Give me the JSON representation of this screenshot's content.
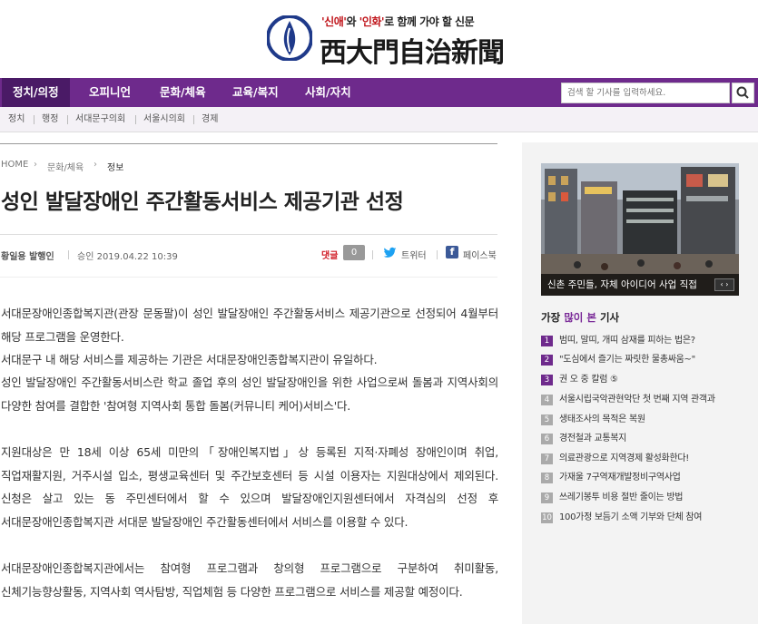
{
  "masthead": {
    "slogan_q1": "'신애'",
    "slogan_mid": "와",
    "slogan_q2": "'인화'",
    "slogan_rest": "로 함께 가야 할 신문",
    "name": "西大門自治新聞"
  },
  "nav": {
    "items": [
      "정치/의정",
      "오피니언",
      "문화/체육",
      "교육/복지",
      "사회/자치"
    ],
    "active_index": 0,
    "search_placeholder": "검색 할 기사를 입력하세요."
  },
  "subnav": {
    "items": [
      "정치",
      "행정",
      "서대문구의회",
      "서울시의회",
      "경제"
    ]
  },
  "breadcrumb": {
    "home": "HOME",
    "section": "문화/체육",
    "current": "정보"
  },
  "article": {
    "headline": "성인 발달장애인 주간활동서비스 제공기관 선정",
    "author": "황일용 발행인",
    "approved": "승인 2019.04.22 10:39",
    "comment_label": "댓글",
    "comment_count": "0",
    "twitter_label": "트위터",
    "facebook_label": "페이스북",
    "paragraphs": [
      "서대문장애인종합복지관(관장 문동팔)이 성인 발달장애인 주간활동서비스 제공기관으로 선정되어 4월부터 해당 프로그램을 운영한다.",
      "서대문구 내 해당 서비스를 제공하는 기관은 서대문장애인종합복지관이 유일하다.",
      "성인 발달장애인 주간활동서비스란 학교 졸업 후의 성인 발달장애인을 위한 사업으로써 돌봄과 지역사회의 다양한 참여를 결합한 '참여형 지역사회 통합 돌봄(커뮤니티 케어)서비스'다.",
      "지원대상은 만 18세 이상 65세 미만의「장애인복지법」상 등록된 지적·자폐성 장애인이며 취업, 직업재활지원, 거주시설 입소, 평생교육센터 및 주간보호센터 등 시설 이용자는 지원대상에서 제외된다. 신청은 살고 있는 동 주민센터에서 할 수 있으며 발달장애인지원센터에서 자격심의 선정 후 서대문장애인종합복지관 서대문 발달장애인 주간활동센터에서 서비스를 이용할 수 있다.",
      "서대문장애인종합복지관에서는 참여형 프로그램과 창의형 프로그램으로 구분하여 취미활동, 신체기능향상활동, 지역사회 역사탐방, 직업체험 등 다양한 프로그램으로 서비스를 제공할 예정이다."
    ]
  },
  "sidebar": {
    "photo_caption": "신촌 주민들, 자체 아이디어 사업 직접",
    "popular_title_pre": "가장",
    "popular_title_hl": "많이 본",
    "popular_title_post": "기사",
    "popular": [
      {
        "rank": "1",
        "title": "범띠, 말띠, 개띠 삼재를 피하는 법은?"
      },
      {
        "rank": "2",
        "title": "\"도심에서 즐기는 짜릿한 물총싸움~\""
      },
      {
        "rank": "3",
        "title": "권 오 중 칼럼 ⑤"
      },
      {
        "rank": "4",
        "title": "서울시립국악관현악단 첫 번째 지역 관객과"
      },
      {
        "rank": "5",
        "title": "생태조사의 목적은 복원"
      },
      {
        "rank": "6",
        "title": "경전철과 교통복지"
      },
      {
        "rank": "7",
        "title": "의료관광으로 지역경제 활성화한다!"
      },
      {
        "rank": "8",
        "title": "가재울 7구역재개발정비구역사업"
      },
      {
        "rank": "9",
        "title": "쓰레기봉투 비용 절반 줄이는 방법"
      },
      {
        "rank": "10",
        "title": "100가정 보듬기 소액 기부와 단체 참여"
      }
    ]
  },
  "colors": {
    "nav_purple": "#6e2a8c",
    "nav_active": "#4a1a66",
    "accent_red": "#c0151b",
    "facebook": "#3b5998",
    "twitter": "#1da1f2"
  }
}
